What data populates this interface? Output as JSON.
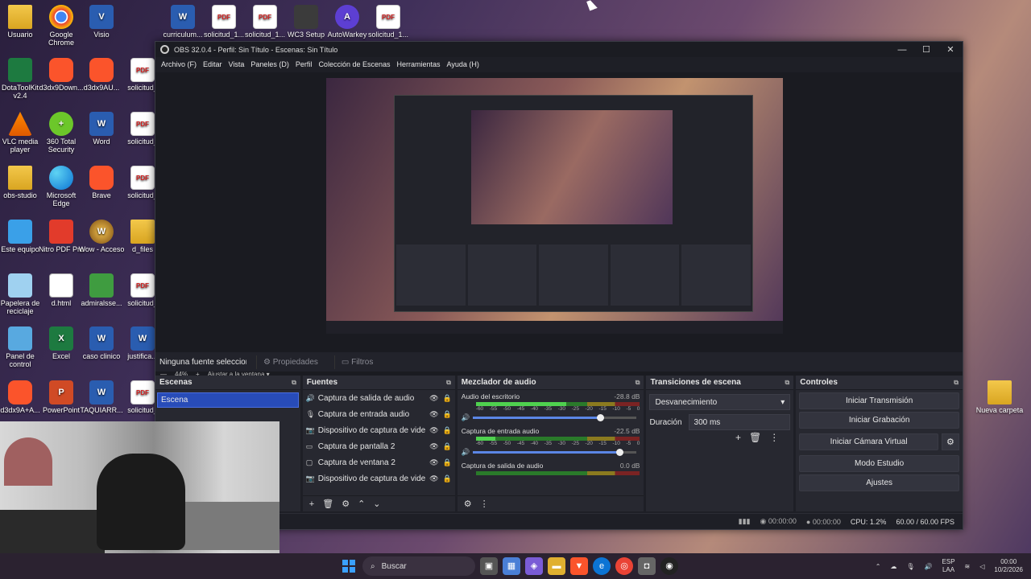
{
  "desktop_icons": [
    {
      "label": "Usuario",
      "icon": "folder-icon",
      "ico_text": ""
    },
    {
      "label": "Google Chrome",
      "icon": "chrome-icon",
      "ico_text": ""
    },
    {
      "label": "Visio",
      "icon": "visio-icon",
      "ico_text": "V"
    },
    {
      "label": "curriculum...",
      "icon": "word-doc-icon",
      "ico_text": "W"
    },
    {
      "label": "solicitud_1...",
      "icon": "pdf-icon",
      "ico_text": "PDF"
    },
    {
      "label": "solicitud_1...",
      "icon": "pdf-icon",
      "ico_text": "PDF"
    },
    {
      "label": "WC3 Setup",
      "icon": "wc3-icon",
      "ico_text": ""
    },
    {
      "label": "AutoWarkey",
      "icon": "autowarkey-icon",
      "ico_text": "A"
    },
    {
      "label": "solicitud_1...",
      "icon": "pdf-icon",
      "ico_text": "PDF"
    },
    {
      "label": "DotaToolKit v2.4",
      "icon": "dotatoolkit-icon",
      "ico_text": ""
    },
    {
      "label": "d3dx9Down...",
      "icon": "brave-icon",
      "ico_text": ""
    },
    {
      "label": "d3dx9AU...",
      "icon": "brave-icon",
      "ico_text": ""
    },
    {
      "label": "solicitud_",
      "icon": "pdf-icon",
      "ico_text": "PDF"
    },
    {
      "label": "VLC media player",
      "icon": "vlc-icon",
      "ico_text": ""
    },
    {
      "label": "360 Total Security",
      "icon": "360-security-icon",
      "ico_text": "+"
    },
    {
      "label": "Word",
      "icon": "word-icon",
      "ico_text": "W"
    },
    {
      "label": "solicitud_",
      "icon": "pdf-icon",
      "ico_text": "PDF"
    },
    {
      "label": "obs-studio",
      "icon": "folder-icon",
      "ico_text": ""
    },
    {
      "label": "Microsoft Edge",
      "icon": "edge-icon",
      "ico_text": ""
    },
    {
      "label": "Brave",
      "icon": "brave-icon",
      "ico_text": ""
    },
    {
      "label": "solicitud_",
      "icon": "pdf-icon",
      "ico_text": "PDF"
    },
    {
      "label": "Este equipo",
      "icon": "computer-icon",
      "ico_text": ""
    },
    {
      "label": "Nitro PDF Pro",
      "icon": "nitro-icon",
      "ico_text": ""
    },
    {
      "label": "Wow - Acceso",
      "icon": "wow-icon",
      "ico_text": "W"
    },
    {
      "label": "d_files",
      "icon": "folder-icon",
      "ico_text": ""
    },
    {
      "label": "Papelera de reciclaje",
      "icon": "recycle-bin-icon",
      "ico_text": ""
    },
    {
      "label": "d.html",
      "icon": "html-file-icon",
      "ico_text": ""
    },
    {
      "label": "admiralsse...",
      "icon": "admiral-icon",
      "ico_text": ""
    },
    {
      "label": "solicitud_",
      "icon": "pdf-icon",
      "ico_text": "PDF"
    },
    {
      "label": "Panel de control",
      "icon": "control-panel-icon",
      "ico_text": ""
    },
    {
      "label": "Excel",
      "icon": "excel-icon",
      "ico_text": "X"
    },
    {
      "label": "caso clinico",
      "icon": "word-doc-icon",
      "ico_text": "W"
    },
    {
      "label": "justifica...",
      "icon": "word-doc-icon",
      "ico_text": "W"
    },
    {
      "label": "d3dx9A+A...",
      "icon": "brave-icon",
      "ico_text": ""
    },
    {
      "label": "PowerPoint",
      "icon": "powerpoint-icon",
      "ico_text": "P"
    },
    {
      "label": "TAQUIARR...",
      "icon": "word-doc-icon",
      "ico_text": "W"
    },
    {
      "label": "solicitud_",
      "icon": "pdf-icon",
      "ico_text": "PDF"
    },
    {
      "label": "Nueva carpeta",
      "icon": "folder-icon",
      "ico_text": ""
    }
  ],
  "window": {
    "title": "OBS 32.0.4 - Perfil: Sin Título - Escenas: Sin Título",
    "minimize": "—",
    "maximize": "☐",
    "close": "✕"
  },
  "menu": [
    "Archivo (F)",
    "Editar",
    "Vista",
    "Paneles (D)",
    "Perfil",
    "Colección de Escenas",
    "Herramientas",
    "Ayuda (H)"
  ],
  "preview": {
    "zoom": "44%",
    "fit_label": "Ajustar a la ventana",
    "minus": "—",
    "plus": "+"
  },
  "source_toolbar": {
    "no_source": "Ninguna fuente seleccionada",
    "properties": "Propiedades",
    "filters": "Filtros"
  },
  "scenes": {
    "title": "Escenas",
    "items": [
      "Escena"
    ]
  },
  "sources": {
    "title": "Fuentes",
    "items": [
      {
        "label": "Captura de salida de audio",
        "icon": "speaker-icon"
      },
      {
        "label": "Captura de entrada audio",
        "icon": "microphone-icon"
      },
      {
        "label": "Dispositivo de captura de vide",
        "icon": "camera-icon"
      },
      {
        "label": "Captura de pantalla 2",
        "icon": "monitor-icon"
      },
      {
        "label": "Captura de ventana 2",
        "icon": "window-icon"
      },
      {
        "label": "Dispositivo de captura de vide",
        "icon": "camera-icon"
      }
    ]
  },
  "mixer": {
    "title": "Mezclador de audio",
    "scale": [
      "-60",
      "-55",
      "-50",
      "-45",
      "-40",
      "-35",
      "-30",
      "-25",
      "-20",
      "-15",
      "-10",
      "-5",
      "0"
    ],
    "channels": [
      {
        "name": "Audio del escritorio",
        "db": "-28.8 dB",
        "level": 0.55,
        "volume": 0.78
      },
      {
        "name": "Captura de entrada audio",
        "db": "-22.5 dB",
        "level": 0.12,
        "volume": 0.9
      },
      {
        "name": "Captura de salida de audio",
        "db": "0.0 dB",
        "level": 0.0,
        "volume": 1.0
      }
    ]
  },
  "transitions": {
    "title": "Transiciones de escena",
    "selected": "Desvanecimiento",
    "duration_label": "Duración",
    "duration_value": "300 ms"
  },
  "controls": {
    "title": "Controles",
    "start_stream": "Iniciar Transmisión",
    "start_recording": "Iniciar Grabación",
    "start_virtual_cam": "Iniciar Cámara Virtual",
    "studio_mode": "Modo Estudio",
    "settings": "Ajustes"
  },
  "status": {
    "rec_time": "00:00:00",
    "stream_time": "00:00:00",
    "cpu": "CPU: 1.2%",
    "fps": "60.00 / 60.00 FPS"
  },
  "taskbar": {
    "search": "Buscar",
    "lang": "ESP",
    "lang_sub": "LAA",
    "time": "00:00",
    "date": "10/2/2026"
  }
}
